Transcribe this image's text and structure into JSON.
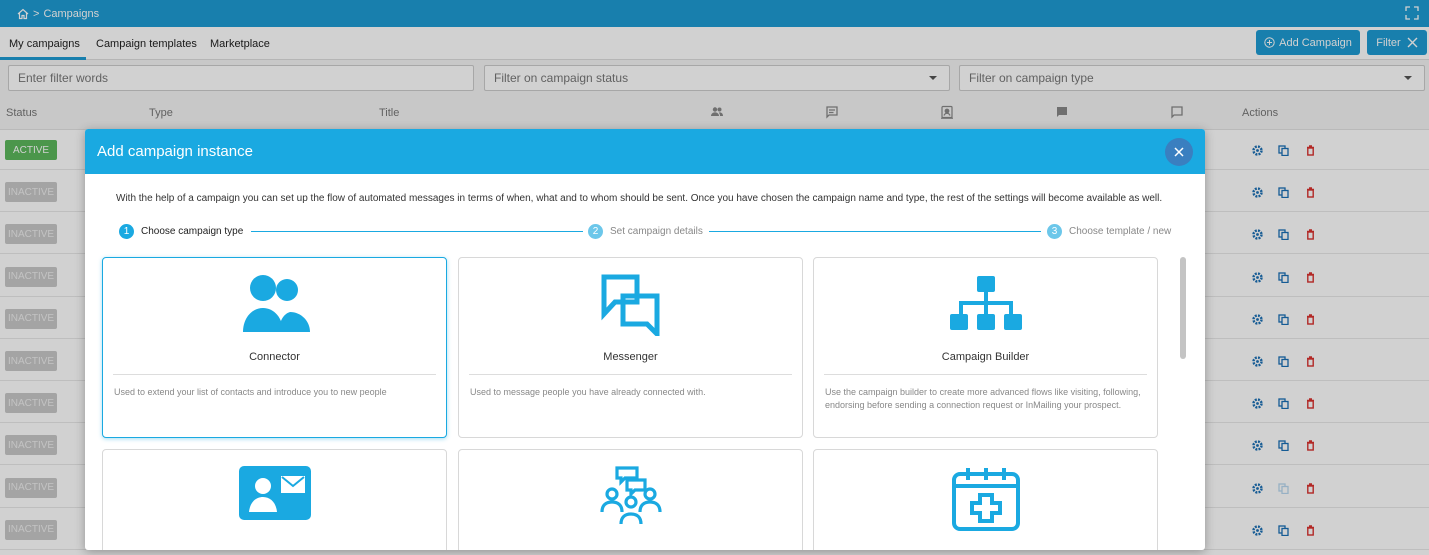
{
  "colors": {
    "brand": "#1e9bd3",
    "modal_header": "#1aa9e1",
    "active": "#5cb85c",
    "delete": "#d9312e"
  },
  "topbar": {
    "breadcrumb": "Campaigns",
    "separator": ">"
  },
  "tabs": [
    {
      "label": "My campaigns",
      "active": true
    },
    {
      "label": "Campaign templates",
      "active": false
    },
    {
      "label": "Marketplace",
      "active": false
    }
  ],
  "toolbar": {
    "add_label": "Add Campaign",
    "filter_label": "Filter"
  },
  "filters": {
    "words_placeholder": "Enter filter words",
    "status_placeholder": "Filter on campaign status",
    "type_placeholder": "Filter on campaign type"
  },
  "table": {
    "columns": {
      "status": "Status",
      "type": "Type",
      "title": "Title",
      "actions": "Actions"
    },
    "rows": [
      {
        "status": "ACTIVE"
      },
      {
        "status": "INACTIVE"
      },
      {
        "status": "INACTIVE"
      },
      {
        "status": "INACTIVE"
      },
      {
        "status": "INACTIVE"
      },
      {
        "status": "INACTIVE"
      },
      {
        "status": "INACTIVE"
      },
      {
        "status": "INACTIVE"
      },
      {
        "status": "INACTIVE"
      },
      {
        "status": "INACTIVE"
      }
    ]
  },
  "modal": {
    "title": "Add campaign instance",
    "intro": "With the help of a campaign you can set up the flow of automated messages in terms of when, what and to whom should be sent. Once you have chosen the campaign name and type, the rest of the settings will become available as well.",
    "steps": [
      {
        "num": "1",
        "label": "Choose campaign type"
      },
      {
        "num": "2",
        "label": "Set campaign details"
      },
      {
        "num": "3",
        "label": "Choose template / new"
      }
    ],
    "cards": [
      {
        "title": "Connector",
        "icon": "users-icon",
        "desc": "Used to extend your list of contacts and introduce you to new people"
      },
      {
        "title": "Messenger",
        "icon": "chat-bubbles-icon",
        "desc": "Used to message people you have already connected with."
      },
      {
        "title": "Campaign Builder",
        "icon": "sitemap-icon",
        "desc": "Use the campaign builder to create more advanced flows like visiting, following, endorsing before sending a connection request or InMailing your prospect."
      },
      {
        "icon": "contact-card-icon"
      },
      {
        "icon": "group-chat-icon"
      },
      {
        "icon": "calendar-plus-icon"
      }
    ]
  }
}
